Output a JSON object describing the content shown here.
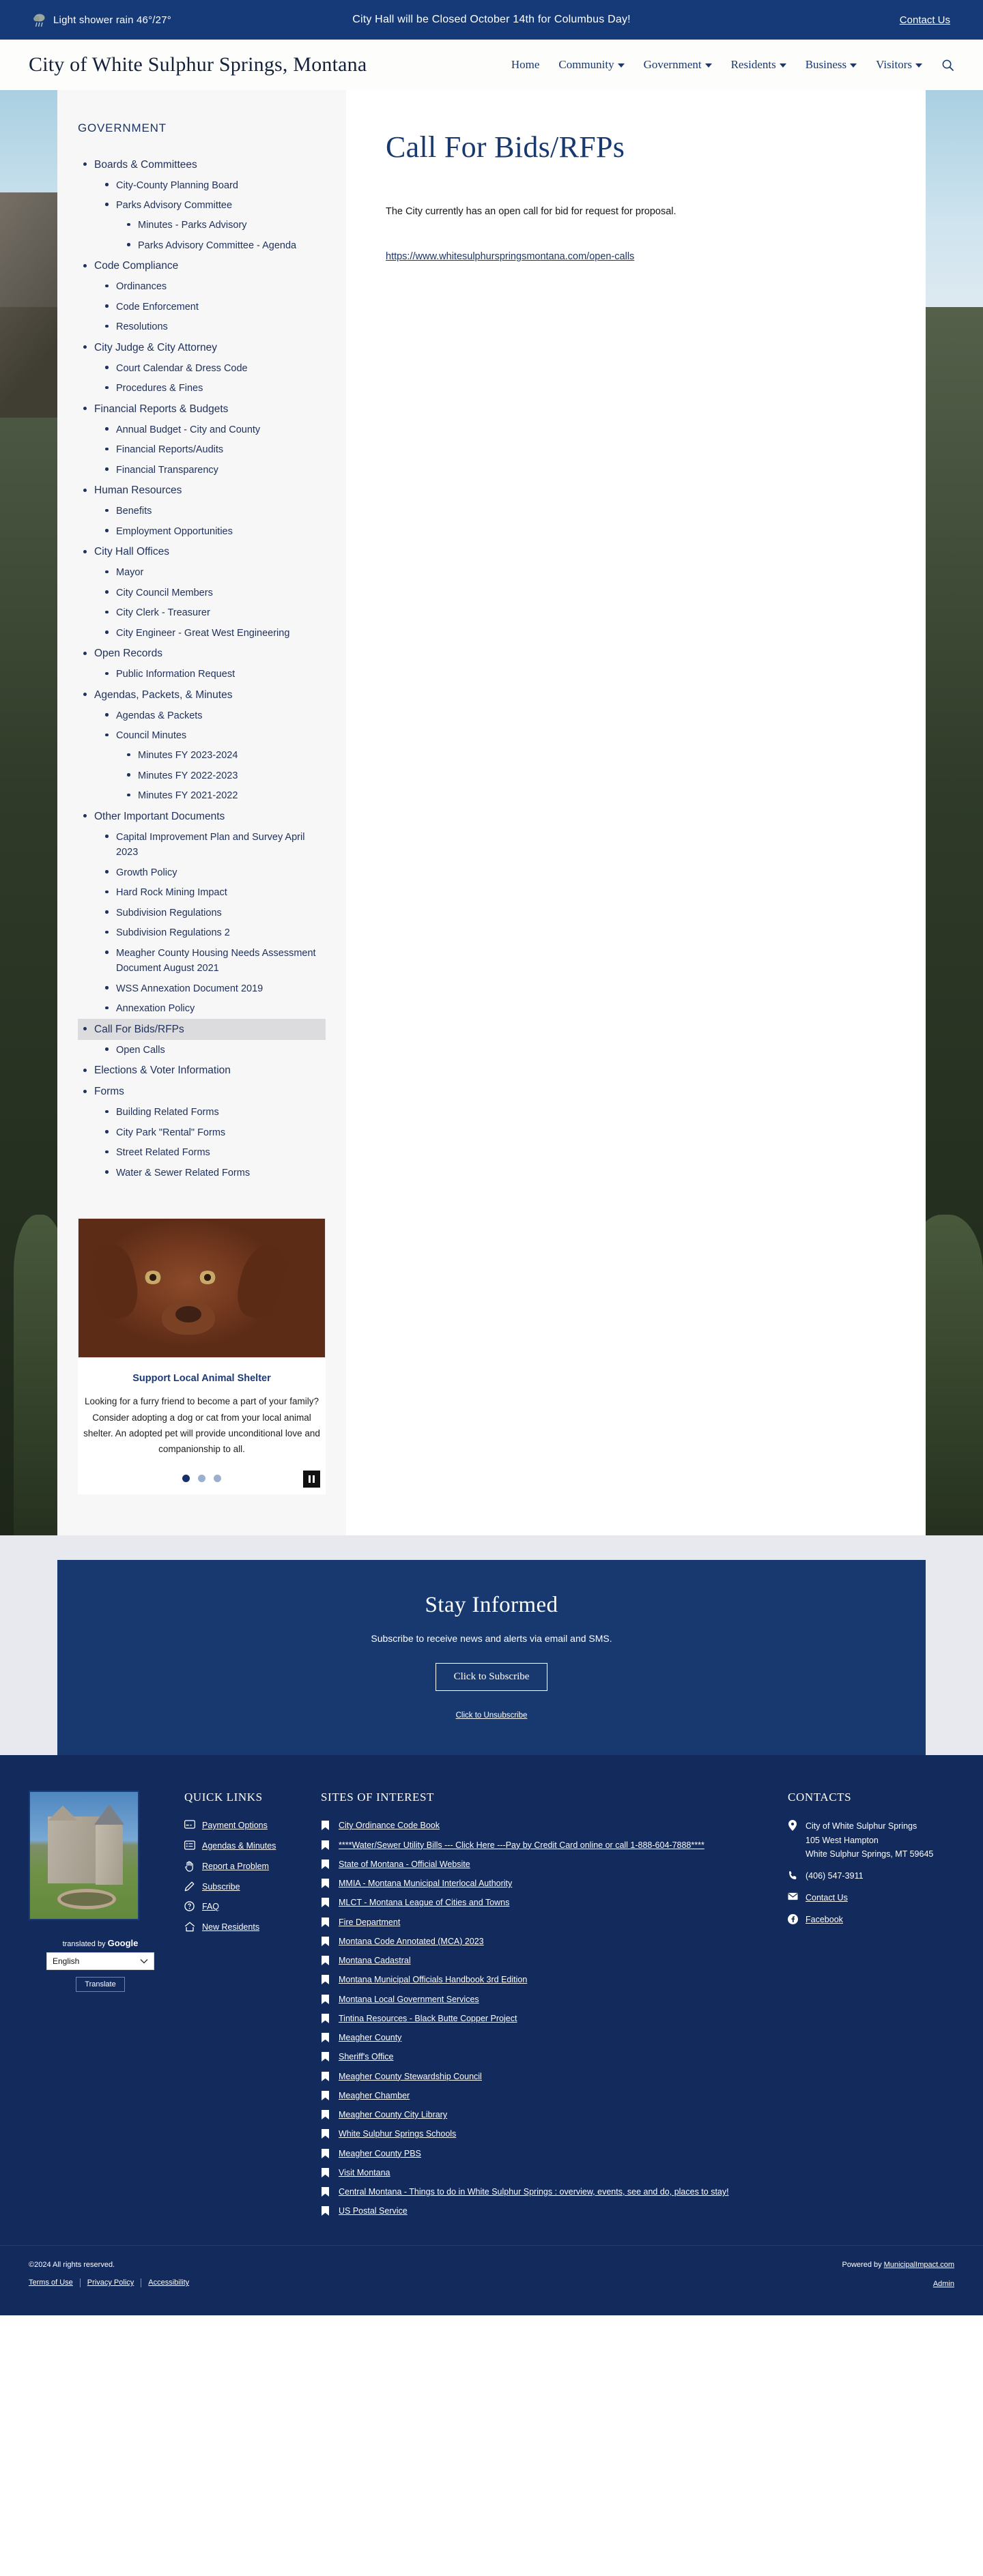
{
  "topbar": {
    "weather_icon": "rain-cloud-icon",
    "weather": "Light shower rain 46°/27°",
    "alert": "City Hall will be Closed October 14th for Columbus Day!",
    "contact_label": "Contact Us"
  },
  "header": {
    "brand": "City of White Sulphur Springs, Montana",
    "nav": [
      {
        "label": "Home",
        "has_caret": false
      },
      {
        "label": "Community",
        "has_caret": true
      },
      {
        "label": "Government",
        "has_caret": true
      },
      {
        "label": "Residents",
        "has_caret": true
      },
      {
        "label": "Business",
        "has_caret": true
      },
      {
        "label": "Visitors",
        "has_caret": true
      }
    ],
    "search_icon": "search-icon"
  },
  "sidebar": {
    "title": "GOVERNMENT",
    "items": [
      {
        "label": "Boards & Committees",
        "level": 1,
        "active": false
      },
      {
        "label": "City-County Planning Board",
        "level": 2,
        "active": false
      },
      {
        "label": "Parks Advisory Committee",
        "level": 2,
        "active": false
      },
      {
        "label": "Minutes - Parks Advisory",
        "level": 3,
        "active": false
      },
      {
        "label": "Parks Advisory Committee - Agenda",
        "level": 3,
        "active": false
      },
      {
        "label": "Code Compliance",
        "level": 1,
        "active": false
      },
      {
        "label": "Ordinances",
        "level": 2,
        "active": false
      },
      {
        "label": "Code Enforcement",
        "level": 2,
        "active": false
      },
      {
        "label": "Resolutions",
        "level": 2,
        "active": false
      },
      {
        "label": "City Judge & City Attorney",
        "level": 1,
        "active": false
      },
      {
        "label": "Court Calendar & Dress Code",
        "level": 2,
        "active": false
      },
      {
        "label": "Procedures & Fines",
        "level": 2,
        "active": false
      },
      {
        "label": "Financial Reports & Budgets",
        "level": 1,
        "active": false
      },
      {
        "label": "Annual Budget - City and County",
        "level": 2,
        "active": false
      },
      {
        "label": "Financial Reports/Audits",
        "level": 2,
        "active": false
      },
      {
        "label": "Financial Transparency",
        "level": 2,
        "active": false
      },
      {
        "label": "Human Resources",
        "level": 1,
        "active": false
      },
      {
        "label": "Benefits",
        "level": 2,
        "active": false
      },
      {
        "label": "Employment Opportunities",
        "level": 2,
        "active": false
      },
      {
        "label": "City Hall Offices",
        "level": 1,
        "active": false
      },
      {
        "label": "Mayor",
        "level": 2,
        "active": false
      },
      {
        "label": "City Council Members",
        "level": 2,
        "active": false
      },
      {
        "label": "City Clerk - Treasurer",
        "level": 2,
        "active": false
      },
      {
        "label": "City Engineer - Great West Engineering",
        "level": 2,
        "active": false
      },
      {
        "label": "Open Records",
        "level": 1,
        "active": false
      },
      {
        "label": "Public Information Request",
        "level": 2,
        "active": false
      },
      {
        "label": "Agendas, Packets, & Minutes",
        "level": 1,
        "active": false
      },
      {
        "label": "Agendas & Packets",
        "level": 2,
        "active": false
      },
      {
        "label": "Council Minutes",
        "level": 2,
        "active": false
      },
      {
        "label": "Minutes FY 2023-2024",
        "level": 3,
        "active": false
      },
      {
        "label": "Minutes FY 2022-2023",
        "level": 3,
        "active": false
      },
      {
        "label": "Minutes FY 2021-2022",
        "level": 3,
        "active": false
      },
      {
        "label": "Other Important Documents",
        "level": 1,
        "active": false
      },
      {
        "label": "Capital Improvement Plan and Survey April 2023",
        "level": 2,
        "active": false
      },
      {
        "label": "Growth Policy",
        "level": 2,
        "active": false
      },
      {
        "label": "Hard Rock Mining Impact",
        "level": 2,
        "active": false
      },
      {
        "label": "Subdivision Regulations",
        "level": 2,
        "active": false
      },
      {
        "label": "Subdivision Regulations 2",
        "level": 2,
        "active": false
      },
      {
        "label": "Meagher County Housing Needs Assessment Document August 2021",
        "level": 2,
        "active": false
      },
      {
        "label": "WSS Annexation Document 2019",
        "level": 2,
        "active": false
      },
      {
        "label": "Annexation Policy",
        "level": 2,
        "active": false
      },
      {
        "label": "Call For Bids/RFPs",
        "level": 1,
        "active": true
      },
      {
        "label": "Open Calls",
        "level": 2,
        "active": false
      },
      {
        "label": "Elections & Voter Information",
        "level": 1,
        "active": false
      },
      {
        "label": "Forms",
        "level": 1,
        "active": false
      },
      {
        "label": "Building Related Forms",
        "level": 2,
        "active": false
      },
      {
        "label": "City Park \"Rental\" Forms",
        "level": 2,
        "active": false
      },
      {
        "label": "Street Related Forms",
        "level": 2,
        "active": false
      },
      {
        "label": "Water & Sewer Related Forms",
        "level": 2,
        "active": false
      }
    ]
  },
  "promo": {
    "image_alt": "dog-photo",
    "title": "Support Local Animal Shelter",
    "text": "Looking for a furry friend to become a part of your family? Consider adopting a dog or cat from your local animal shelter. An adopted pet will provide unconditional love and companionship to all.",
    "dots": 3,
    "active_dot": 0,
    "pause_icon": "pause-icon"
  },
  "main": {
    "title": "Call For Bids/RFPs",
    "paragraph": "The City currently has an open call for bid for request for proposal.",
    "link": "https://www.whitesulphurspringsmontana.com/open-calls"
  },
  "stay_informed": {
    "heading": "Stay Informed",
    "subtext": "Subscribe to receive news and alerts via email and SMS.",
    "button": "Click to Subscribe",
    "unsubscribe": "Click to Unsubscribe"
  },
  "footer": {
    "building_image_alt": "historic-castle-building-photo",
    "quick_links": {
      "heading": "QUICK LINKS",
      "items": [
        {
          "label": "Payment Options",
          "icon": "credit-card-icon"
        },
        {
          "label": "Agendas & Minutes",
          "icon": "list-icon"
        },
        {
          "label": "Report a Problem",
          "icon": "hand-icon"
        },
        {
          "label": "Subscribe",
          "icon": "pencil-icon"
        },
        {
          "label": "FAQ",
          "icon": "question-circle-icon"
        },
        {
          "label": "New Residents",
          "icon": "home-icon"
        }
      ]
    },
    "sites_of_interest": {
      "heading": "SITES OF INTEREST",
      "icon": "bookmark-icon",
      "items": [
        "City Ordinance Code Book",
        "****Water/Sewer Utility Bills --- Click Here ---Pay by Credit Card online or call 1-888-604-7888****",
        "State of Montana - Official Website",
        "MMIA - Montana Municipal Interlocal Authority",
        "MLCT - Montana League of Cities and Towns",
        "Fire Department",
        "Montana Code Annotated (MCA) 2023",
        "Montana Cadastral",
        "Montana Municipal Officials Handbook 3rd Edition",
        "Montana Local Government Services",
        "Tintina Resources - Black Butte Copper Project",
        "Meagher County",
        "Sheriff's Office",
        "Meagher County Stewardship Council",
        "Meagher Chamber",
        "Meagher County City Library",
        "White Sulphur Springs Schools",
        "Meagher County PBS",
        "Visit Montana",
        "Central Montana - Things to do in White Sulphur Springs : overview, events, see and do, places to stay!",
        "US Postal Service"
      ]
    },
    "contacts": {
      "heading": "CONTACTS",
      "address_icon": "location-pin-icon",
      "address": "City of White Sulphur Springs\n105 West Hampton\nWhite Sulphur Springs, MT 59645",
      "phone_icon": "phone-icon",
      "phone": "(406) 547-3911",
      "email_icon": "envelope-icon",
      "email_label": "Contact Us",
      "social_icon": "facebook-icon",
      "social_label": "Facebook"
    },
    "translate": {
      "label_prefix": "translated by",
      "label_brand": "Google",
      "selected_language": "English",
      "chevron_icon": "chevron-down-icon",
      "button": "Translate"
    },
    "bottom": {
      "copyright": "©2024 All rights reserved.",
      "terms": "Terms of Use",
      "privacy": "Privacy Policy",
      "accessibility": "Accessibility",
      "powered_prefix": "Powered by ",
      "powered_link": "MunicipalImpact.com",
      "admin": "Admin"
    }
  },
  "colors": {
    "navy": "#163a78",
    "footer_navy": "#122a5c",
    "text_navy": "#20325c",
    "sidebar_bg": "#f7f7f8",
    "active_bg": "#dcdcde"
  }
}
